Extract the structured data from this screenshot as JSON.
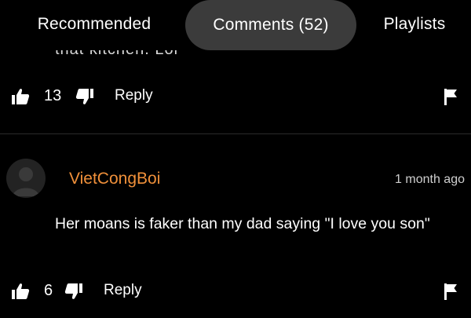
{
  "tabs": {
    "recommended": "Recommended",
    "comments": "Comments (52)",
    "playlists": "Playlists"
  },
  "previous_comment": {
    "cut_text": "that kitchen. Lol",
    "likes": "13",
    "reply_label": "Reply"
  },
  "comment": {
    "username": "VietCongBoi",
    "time": "1 month ago",
    "text": "Her moans is faker than my dad saying \"I love you son\"",
    "likes": "6",
    "reply_label": "Reply"
  },
  "icons": [
    "thumbs-up-icon",
    "thumbs-down-icon",
    "flag-icon",
    "avatar-icon"
  ],
  "colors": {
    "background": "#000000",
    "active_tab": "#3b3b3b",
    "username": "#f0903a",
    "text": "#ffffff"
  }
}
